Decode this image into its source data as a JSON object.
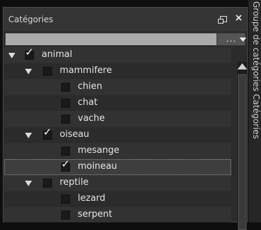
{
  "panel": {
    "title": "Catégories",
    "group_select": {
      "value": "",
      "more_label": "..."
    }
  },
  "side_tab": {
    "label": "Groupe de catégories Catégories"
  },
  "tree": {
    "items": [
      {
        "label": "animal",
        "level": 0,
        "expanded": true,
        "checked": true,
        "selected": false
      },
      {
        "label": "mammifere",
        "level": 1,
        "expanded": true,
        "checked": false,
        "selected": false
      },
      {
        "label": "chien",
        "level": 2,
        "checked": false,
        "selected": false
      },
      {
        "label": "chat",
        "level": 2,
        "checked": false,
        "selected": false
      },
      {
        "label": "vache",
        "level": 2,
        "checked": false,
        "selected": false
      },
      {
        "label": "oiseau",
        "level": 1,
        "expanded": true,
        "checked": true,
        "selected": false
      },
      {
        "label": "mesange",
        "level": 2,
        "checked": false,
        "selected": false
      },
      {
        "label": "moineau",
        "level": 2,
        "checked": true,
        "selected": true
      },
      {
        "label": "reptile",
        "level": 1,
        "expanded": true,
        "checked": false,
        "selected": false
      },
      {
        "label": "lezard",
        "level": 2,
        "checked": false,
        "selected": false
      },
      {
        "label": "serpent",
        "level": 2,
        "checked": false,
        "selected": false
      }
    ]
  },
  "colors": {
    "panel_bg": "#2b2b2b",
    "titlebar_bg": "#353535",
    "input_bg": "#aaaaaa"
  }
}
